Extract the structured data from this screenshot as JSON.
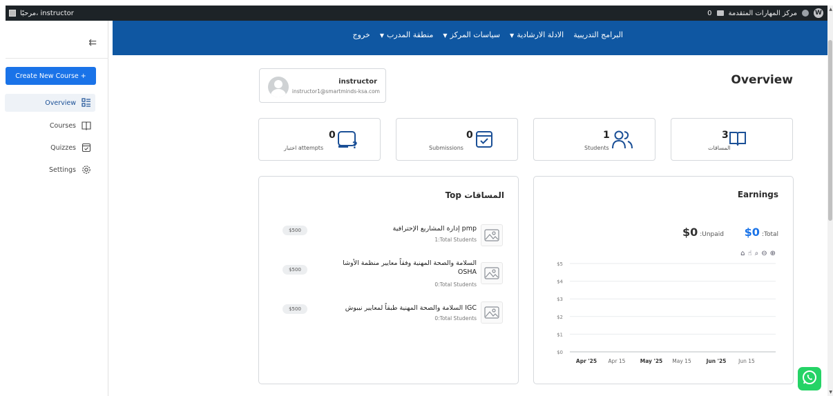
{
  "adminbar": {
    "greeting": "مرحبًا، instructor",
    "site_name": "مركز المهارات المتقدمة",
    "comment_count": "0"
  },
  "sidebar": {
    "create_label": "Create New Course +",
    "items": [
      {
        "label": "Overview",
        "icon": "overview-icon"
      },
      {
        "label": "Courses",
        "icon": "book-icon"
      },
      {
        "label": "Quizzes",
        "icon": "quiz-icon"
      },
      {
        "label": "Settings",
        "icon": "gear-icon"
      }
    ]
  },
  "topnav": {
    "items": [
      "البرامج التدريبية",
      "الادلة الارشادية",
      "سياسات المركز",
      "منطقة المدرب",
      "خروج"
    ]
  },
  "main": {
    "title": "Overview",
    "profile": {
      "name": "instructor",
      "email": "instructor1@smartminds-ksa.com"
    },
    "stats": [
      {
        "value": "3",
        "label": "المساقات",
        "icon": "book-icon"
      },
      {
        "value": "1",
        "label": "Students",
        "icon": "users-icon"
      },
      {
        "value": "0",
        "label": "Submissions",
        "icon": "submission-icon"
      },
      {
        "value": "0",
        "label": "اختبار attempts",
        "icon": "quiz-attempt-icon"
      }
    ],
    "earnings": {
      "title": "Earnings",
      "total_label": ":Total",
      "total_value": "$0",
      "unpaid_label": ":Unpaid",
      "unpaid_value": "$0"
    },
    "top_courses": {
      "title": "Top المساقات",
      "items": [
        {
          "title": "إدارة المشاريع الإحترافية pmp",
          "students": "1:Total Students",
          "price": "$500"
        },
        {
          "title": "السلامة والصحة المهنية وفقاً معايير منظمة الأوشا OSHA",
          "students": "0:Total Students",
          "price": "$500"
        },
        {
          "title": "السلامة والصحة المهنية طبقاً لمعايير نيبوش IGC",
          "students": "0:Total Students",
          "price": "$500"
        }
      ]
    }
  },
  "chart_data": {
    "type": "line",
    "title": "",
    "x_tick_labels": [
      "Apr '25",
      "Apr 15",
      "May '25",
      "May 15",
      "Jun '25",
      "Jun 15"
    ],
    "y_tick_labels": [
      "$5",
      "$4",
      "$3",
      "$2",
      "$1",
      "$0"
    ],
    "ylim": [
      0,
      5
    ],
    "series": [],
    "grid": true
  }
}
